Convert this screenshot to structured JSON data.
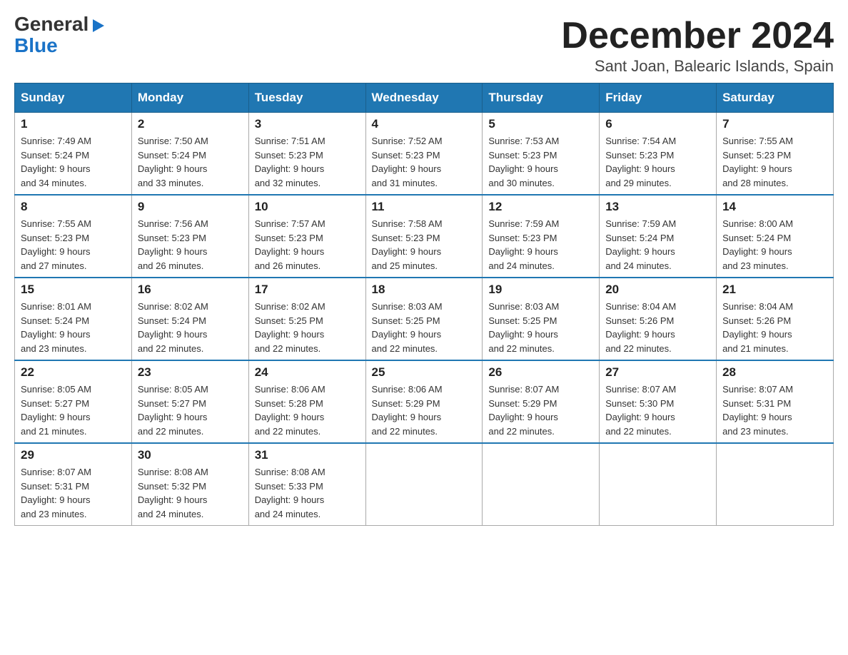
{
  "header": {
    "logo_line1": "General",
    "logo_line2": "Blue",
    "title": "December 2024",
    "subtitle": "Sant Joan, Balearic Islands, Spain"
  },
  "weekdays": [
    "Sunday",
    "Monday",
    "Tuesday",
    "Wednesday",
    "Thursday",
    "Friday",
    "Saturday"
  ],
  "weeks": [
    [
      {
        "day": "1",
        "sunrise": "7:49 AM",
        "sunset": "5:24 PM",
        "daylight": "9 hours and 34 minutes."
      },
      {
        "day": "2",
        "sunrise": "7:50 AM",
        "sunset": "5:24 PM",
        "daylight": "9 hours and 33 minutes."
      },
      {
        "day": "3",
        "sunrise": "7:51 AM",
        "sunset": "5:23 PM",
        "daylight": "9 hours and 32 minutes."
      },
      {
        "day": "4",
        "sunrise": "7:52 AM",
        "sunset": "5:23 PM",
        "daylight": "9 hours and 31 minutes."
      },
      {
        "day": "5",
        "sunrise": "7:53 AM",
        "sunset": "5:23 PM",
        "daylight": "9 hours and 30 minutes."
      },
      {
        "day": "6",
        "sunrise": "7:54 AM",
        "sunset": "5:23 PM",
        "daylight": "9 hours and 29 minutes."
      },
      {
        "day": "7",
        "sunrise": "7:55 AM",
        "sunset": "5:23 PM",
        "daylight": "9 hours and 28 minutes."
      }
    ],
    [
      {
        "day": "8",
        "sunrise": "7:55 AM",
        "sunset": "5:23 PM",
        "daylight": "9 hours and 27 minutes."
      },
      {
        "day": "9",
        "sunrise": "7:56 AM",
        "sunset": "5:23 PM",
        "daylight": "9 hours and 26 minutes."
      },
      {
        "day": "10",
        "sunrise": "7:57 AM",
        "sunset": "5:23 PM",
        "daylight": "9 hours and 26 minutes."
      },
      {
        "day": "11",
        "sunrise": "7:58 AM",
        "sunset": "5:23 PM",
        "daylight": "9 hours and 25 minutes."
      },
      {
        "day": "12",
        "sunrise": "7:59 AM",
        "sunset": "5:23 PM",
        "daylight": "9 hours and 24 minutes."
      },
      {
        "day": "13",
        "sunrise": "7:59 AM",
        "sunset": "5:24 PM",
        "daylight": "9 hours and 24 minutes."
      },
      {
        "day": "14",
        "sunrise": "8:00 AM",
        "sunset": "5:24 PM",
        "daylight": "9 hours and 23 minutes."
      }
    ],
    [
      {
        "day": "15",
        "sunrise": "8:01 AM",
        "sunset": "5:24 PM",
        "daylight": "9 hours and 23 minutes."
      },
      {
        "day": "16",
        "sunrise": "8:02 AM",
        "sunset": "5:24 PM",
        "daylight": "9 hours and 22 minutes."
      },
      {
        "day": "17",
        "sunrise": "8:02 AM",
        "sunset": "5:25 PM",
        "daylight": "9 hours and 22 minutes."
      },
      {
        "day": "18",
        "sunrise": "8:03 AM",
        "sunset": "5:25 PM",
        "daylight": "9 hours and 22 minutes."
      },
      {
        "day": "19",
        "sunrise": "8:03 AM",
        "sunset": "5:25 PM",
        "daylight": "9 hours and 22 minutes."
      },
      {
        "day": "20",
        "sunrise": "8:04 AM",
        "sunset": "5:26 PM",
        "daylight": "9 hours and 22 minutes."
      },
      {
        "day": "21",
        "sunrise": "8:04 AM",
        "sunset": "5:26 PM",
        "daylight": "9 hours and 21 minutes."
      }
    ],
    [
      {
        "day": "22",
        "sunrise": "8:05 AM",
        "sunset": "5:27 PM",
        "daylight": "9 hours and 21 minutes."
      },
      {
        "day": "23",
        "sunrise": "8:05 AM",
        "sunset": "5:27 PM",
        "daylight": "9 hours and 22 minutes."
      },
      {
        "day": "24",
        "sunrise": "8:06 AM",
        "sunset": "5:28 PM",
        "daylight": "9 hours and 22 minutes."
      },
      {
        "day": "25",
        "sunrise": "8:06 AM",
        "sunset": "5:29 PM",
        "daylight": "9 hours and 22 minutes."
      },
      {
        "day": "26",
        "sunrise": "8:07 AM",
        "sunset": "5:29 PM",
        "daylight": "9 hours and 22 minutes."
      },
      {
        "day": "27",
        "sunrise": "8:07 AM",
        "sunset": "5:30 PM",
        "daylight": "9 hours and 22 minutes."
      },
      {
        "day": "28",
        "sunrise": "8:07 AM",
        "sunset": "5:31 PM",
        "daylight": "9 hours and 23 minutes."
      }
    ],
    [
      {
        "day": "29",
        "sunrise": "8:07 AM",
        "sunset": "5:31 PM",
        "daylight": "9 hours and 23 minutes."
      },
      {
        "day": "30",
        "sunrise": "8:08 AM",
        "sunset": "5:32 PM",
        "daylight": "9 hours and 24 minutes."
      },
      {
        "day": "31",
        "sunrise": "8:08 AM",
        "sunset": "5:33 PM",
        "daylight": "9 hours and 24 minutes."
      },
      null,
      null,
      null,
      null
    ]
  ],
  "labels": {
    "sunrise": "Sunrise:",
    "sunset": "Sunset:",
    "daylight": "Daylight:"
  }
}
